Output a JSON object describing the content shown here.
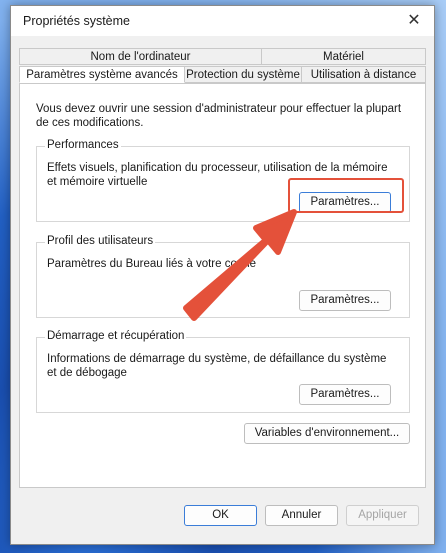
{
  "window": {
    "title": "Propriétés système",
    "close_glyph": "✕"
  },
  "tabs_row1": [
    "Nom de l'ordinateur",
    "Matériel"
  ],
  "tabs_row2": [
    "Paramètres système avancés",
    "Protection du système",
    "Utilisation à distance"
  ],
  "intro": "Vous devez ouvrir une session d'administrateur pour effectuer la plupart de ces modifications.",
  "performance": {
    "title": "Performances",
    "description": "Effets visuels, planification du processeur, utilisation de la mémoire et mémoire virtuelle",
    "button": "Paramètres..."
  },
  "profiles": {
    "title": "Profil des utilisateurs",
    "description": "Paramètres du Bureau liés à votre conne",
    "button": "Paramètres..."
  },
  "startup": {
    "title": "Démarrage et récupération",
    "description": "Informations de démarrage du système, de défaillance du système et de débogage",
    "button": "Paramètres..."
  },
  "env_button": "Variables d'environnement...",
  "footer": {
    "ok": "OK",
    "cancel": "Annuler",
    "apply": "Appliquer"
  },
  "annotation": {
    "color": "#e4513a",
    "icon": "arrow-icon"
  }
}
